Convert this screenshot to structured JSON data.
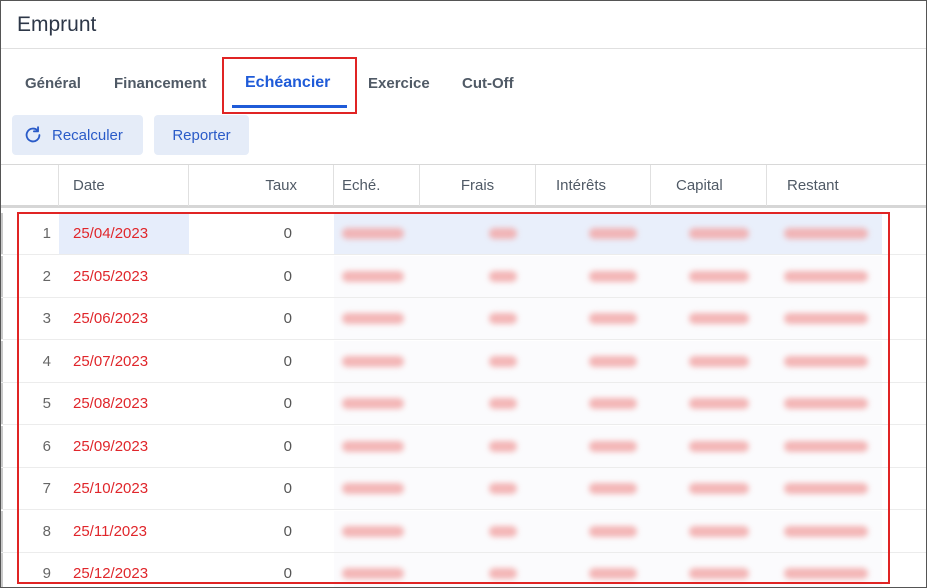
{
  "window": {
    "title": "Emprunt"
  },
  "tabs": [
    {
      "label": "Général"
    },
    {
      "label": "Financement"
    },
    {
      "label": "Echéancier",
      "active": true
    },
    {
      "label": "Exercice"
    },
    {
      "label": "Cut-Off"
    }
  ],
  "toolbar": {
    "recalc_label": "Recalculer",
    "recalc_icon": "refresh-icon",
    "report_label": "Reporter"
  },
  "table": {
    "columns": [
      "Date",
      "Taux",
      "Eché.",
      "Frais",
      "Intérêts",
      "Capital",
      "Restant"
    ],
    "rows": [
      {
        "idx": "1",
        "date": "25/04/2023",
        "taux": "0"
      },
      {
        "idx": "2",
        "date": "25/05/2023",
        "taux": "0"
      },
      {
        "idx": "3",
        "date": "25/06/2023",
        "taux": "0"
      },
      {
        "idx": "4",
        "date": "25/07/2023",
        "taux": "0"
      },
      {
        "idx": "5",
        "date": "25/08/2023",
        "taux": "0"
      },
      {
        "idx": "6",
        "date": "25/09/2023",
        "taux": "0"
      },
      {
        "idx": "7",
        "date": "25/10/2023",
        "taux": "0"
      },
      {
        "idx": "8",
        "date": "25/11/2023",
        "taux": "0"
      },
      {
        "idx": "9",
        "date": "25/12/2023",
        "taux": "0"
      }
    ]
  },
  "colors": {
    "accent": "#1f5bd8",
    "date_text": "#e0262b",
    "highlight_border": "#e02424",
    "selected_row": "#e6edfb"
  }
}
